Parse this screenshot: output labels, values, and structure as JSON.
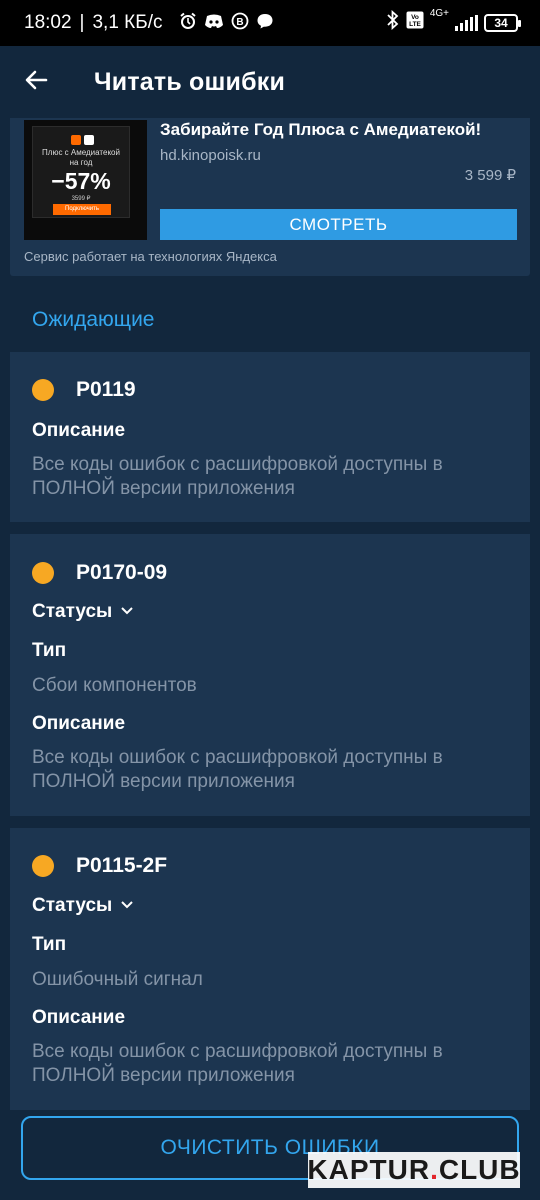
{
  "status_bar": {
    "time": "18:02",
    "speed": "3,1 КБ/с",
    "network": "4G+",
    "battery": "34",
    "icons": [
      "alarm-icon",
      "discord-icon",
      "vk-icon",
      "chat-icon",
      "bluetooth-icon",
      "volte-icon",
      "signal-icon",
      "battery-icon"
    ]
  },
  "app_bar": {
    "title": "Читать ошибки",
    "back_icon": "arrow-left-icon"
  },
  "ad": {
    "thumb_line1": "Плюс с Амедиатекой",
    "thumb_line2": "на год",
    "thumb_percent": "−57%",
    "thumb_price": "3599 ₽",
    "thumb_cta": "Подключить",
    "title": "Забирайте Год Плюса с Амедиатекой!",
    "domain": "hd.kinopoisk.ru",
    "price": "3 599 ₽",
    "button": "СМОТРЕТЬ",
    "note": "Сервис работает на технологиях Яндекса"
  },
  "section": {
    "label": "Ожидающие"
  },
  "cards": [
    {
      "code": "P0119",
      "description_label": "Описание",
      "description": "Все коды ошибок с расшифровкой доступны в ПОЛНОЙ версии приложения"
    },
    {
      "code": "P0170-09",
      "statuses_label": "Статусы",
      "type_label": "Тип",
      "type": "Сбои компонентов",
      "description_label": "Описание",
      "description": "Все коды ошибок с расшифровкой доступны в ПОЛНОЙ версии приложения"
    },
    {
      "code": "P0115-2F",
      "statuses_label": "Статусы",
      "type_label": "Тип",
      "type": "Ошибочный сигнал",
      "description_label": "Описание",
      "description": "Все коды ошибок с расшифровкой доступны в ПОЛНОЙ версии приложения"
    }
  ],
  "clear_button": "ОЧИСТИТЬ ОШИБКИ",
  "watermark": {
    "part1": "KAPTUR",
    "part2": ".",
    "part3": "CLUB"
  },
  "colors": {
    "background": "#12273d",
    "card": "#1c3550",
    "accent": "#33a6ee",
    "pending_dot": "#f7a823"
  }
}
